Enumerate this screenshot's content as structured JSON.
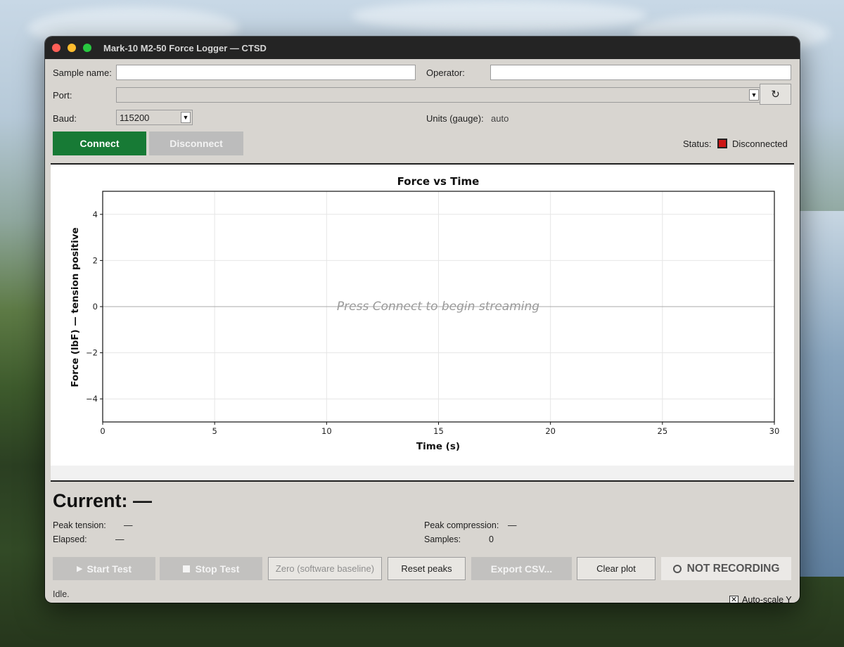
{
  "window": {
    "title": "Mark-10 M2-50 Force Logger — CTSD"
  },
  "form": {
    "sample_name_label": "Sample name:",
    "sample_name_value": "",
    "operator_label": "Operator:",
    "operator_value": "",
    "port_label": "Port:",
    "port_value": "",
    "baud_label": "Baud:",
    "baud_value": "115200",
    "units_label": "Units (gauge):",
    "units_value": "auto"
  },
  "connection": {
    "connect_label": "Connect",
    "disconnect_label": "Disconnect",
    "status_label": "Status:",
    "status_value": "Disconnected",
    "status_color": "#cc1515"
  },
  "chart_data": {
    "type": "line",
    "title": "Force vs Time",
    "xlabel": "Time (s)",
    "ylabel": "Force (lbF)  —  tension positive",
    "xlim": [
      0,
      30
    ],
    "ylim": [
      -5,
      5
    ],
    "xticks": [
      0,
      5,
      10,
      15,
      20,
      25,
      30
    ],
    "yticks": [
      -4,
      -2,
      0,
      2,
      4
    ],
    "xtick_labels": [
      "0",
      "5",
      "10",
      "15",
      "20",
      "25",
      "30"
    ],
    "ytick_labels": [
      "−4",
      "−2",
      "0",
      "2",
      "4"
    ],
    "grid": true,
    "zero_line": 0,
    "series": [],
    "placeholder": "Press Connect to begin streaming"
  },
  "autoscale": {
    "label": "Auto-scale Y",
    "checked": true,
    "mark": "✕"
  },
  "readout": {
    "current_label": "Current:",
    "current_value": "—",
    "peak_tension_label": "Peak tension:",
    "peak_tension_value": "—",
    "elapsed_label": "Elapsed:",
    "elapsed_value": "—",
    "peak_compression_label": "Peak compression:",
    "peak_compression_value": "—",
    "samples_label": "Samples:",
    "samples_value": "0"
  },
  "actions": {
    "start_label": "Start Test",
    "start_icon": "▶",
    "stop_label": "Stop Test",
    "zero_label": "Zero (software baseline)",
    "reset_label": "Reset peaks",
    "export_label": "Export CSV...",
    "clear_label": "Clear plot",
    "recording_label": "NOT RECORDING"
  },
  "status_bar": {
    "text": "Idle."
  }
}
